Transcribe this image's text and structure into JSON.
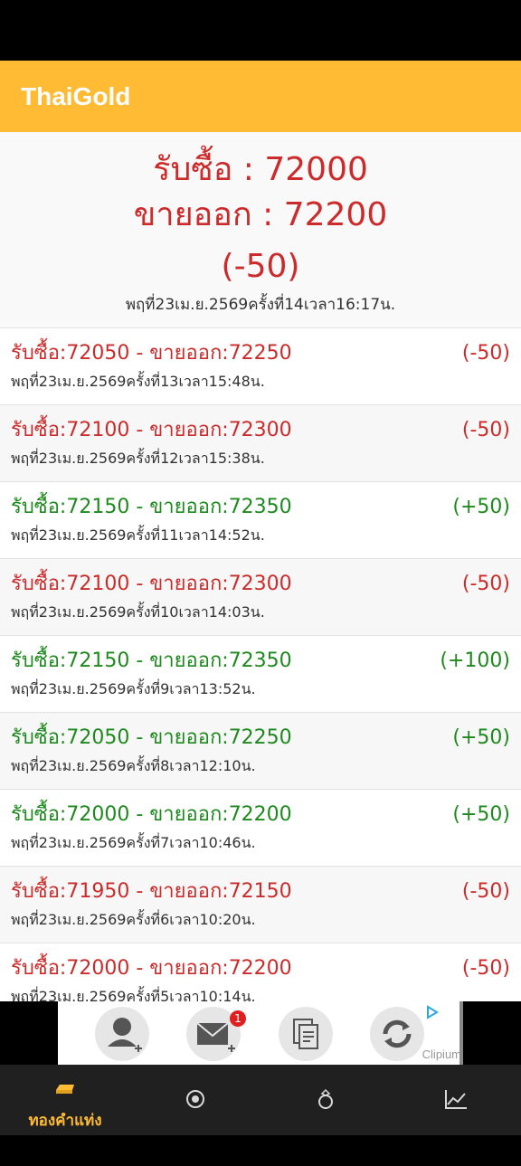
{
  "app": {
    "title": "ThaiGold"
  },
  "summary": {
    "buy": "รับซื้อ : 72000",
    "sell": "ขายออก : 72200",
    "change": "(-50)",
    "time": "พฤที่23เม.ย.2569ครั้งที่14เวลา16:17น."
  },
  "history": [
    {
      "price": "รับซื้อ:72050 - ขายออก:72250",
      "change": "(-50)",
      "time": "พฤที่23เม.ย.2569ครั้งที่13เวลา15:48น.",
      "trend": "down"
    },
    {
      "price": "รับซื้อ:72100 - ขายออก:72300",
      "change": "(-50)",
      "time": "พฤที่23เม.ย.2569ครั้งที่12เวลา15:38น.",
      "trend": "down"
    },
    {
      "price": "รับซื้อ:72150 - ขายออก:72350",
      "change": "(+50)",
      "time": "พฤที่23เม.ย.2569ครั้งที่11เวลา14:52น.",
      "trend": "up"
    },
    {
      "price": "รับซื้อ:72100 - ขายออก:72300",
      "change": "(-50)",
      "time": "พฤที่23เม.ย.2569ครั้งที่10เวลา14:03น.",
      "trend": "down"
    },
    {
      "price": "รับซื้อ:72150 - ขายออก:72350",
      "change": "(+100)",
      "time": "พฤที่23เม.ย.2569ครั้งที่9เวลา13:52น.",
      "trend": "up"
    },
    {
      "price": "รับซื้อ:72050 - ขายออก:72250",
      "change": "(+50)",
      "time": "พฤที่23เม.ย.2569ครั้งที่8เวลา12:10น.",
      "trend": "up"
    },
    {
      "price": "รับซื้อ:72000 - ขายออก:72200",
      "change": "(+50)",
      "time": "พฤที่23เม.ย.2569ครั้งที่7เวลา10:46น.",
      "trend": "up"
    },
    {
      "price": "รับซื้อ:71950 - ขายออก:72150",
      "change": "(-50)",
      "time": "พฤที่23เม.ย.2569ครั้งที่6เวลา10:20น.",
      "trend": "down"
    },
    {
      "price": "รับซื้อ:72000 - ขายออก:72200",
      "change": "(-50)",
      "time": "พฤที่23เม.ย.2569ครั้งที่5เวลา10:14น.",
      "trend": "down"
    }
  ],
  "ad": {
    "badge": "1",
    "brand": "Clipium"
  },
  "nav": [
    {
      "label": "ทองคำแท่ง",
      "icon": "gold-bar-icon",
      "active": true
    },
    {
      "label": "",
      "icon": "target-icon",
      "active": false
    },
    {
      "label": "",
      "icon": "ring-icon",
      "active": false
    },
    {
      "label": "",
      "icon": "chart-line-icon",
      "active": false
    }
  ],
  "colors": {
    "accent": "#FFBB33",
    "down": "#cc2b2b",
    "up": "#1e8a1e",
    "nav_bg": "#202020"
  }
}
